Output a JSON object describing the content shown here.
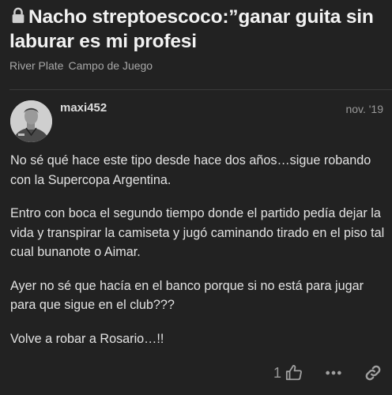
{
  "topic": {
    "title": "Nacho streptoescoco:”ganar guita sin laburar es mi profesi",
    "lock_icon": "lock-icon",
    "breadcrumbs": [
      "River Plate",
      "Campo de Juego"
    ]
  },
  "post": {
    "username": "maxi452",
    "date": "nov. '19",
    "paragraphs": [
      "No sé qué hace este tipo desde hace dos años…sigue robando con la Supercopa Argentina.",
      "Entro con boca el segundo tiempo donde el partido pedía dejar la vida y transpirar la camiseta y jugó caminando tirado en el piso tal cual bunanote o Aimar.",
      "Ayer no sé que hacía en el banco porque si no está para jugar para que sigue en el club???",
      "Volve a robar a Rosario…!!"
    ],
    "actions": {
      "like_count": "1",
      "like_icon": "thumbs-up-icon",
      "more_icon": "ellipsis-icon",
      "share_icon": "link-icon"
    }
  },
  "colors": {
    "background": "#222222",
    "title": "#f2f2f2",
    "muted": "#a8a8a8",
    "body_text": "#e2e2e2"
  }
}
